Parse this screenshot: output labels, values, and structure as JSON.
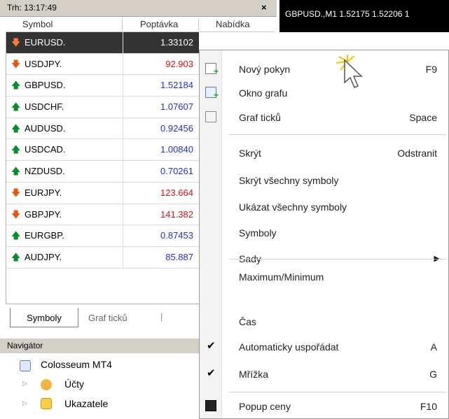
{
  "market_watch": {
    "title": "Trh: 13:17:49",
    "close_glyph": "×",
    "columns": {
      "symbol": "Symbol",
      "bid": "Poptávka",
      "ask": "Nabídka"
    },
    "rows": [
      {
        "symbol": "EURUSD.",
        "bid": "1.33102",
        "dir": "down",
        "selected": true
      },
      {
        "symbol": "USDJPY.",
        "bid": "92.903",
        "dir": "down"
      },
      {
        "symbol": "GBPUSD.",
        "bid": "1.52184",
        "dir": "up"
      },
      {
        "symbol": "USDCHF.",
        "bid": "1.07607",
        "dir": "up"
      },
      {
        "symbol": "AUDUSD.",
        "bid": "0.92456",
        "dir": "up"
      },
      {
        "symbol": "USDCAD.",
        "bid": "1.00840",
        "dir": "up"
      },
      {
        "symbol": "NZDUSD.",
        "bid": "0.70261",
        "dir": "up"
      },
      {
        "symbol": "EURJPY.",
        "bid": "123.664",
        "dir": "down"
      },
      {
        "symbol": "GBPJPY.",
        "bid": "141.382",
        "dir": "down"
      },
      {
        "symbol": "EURGBP.",
        "bid": "0.87453",
        "dir": "up"
      },
      {
        "symbol": "AUDJPY.",
        "bid": "85.887",
        "dir": "up"
      }
    ],
    "tabs": {
      "symbols": "Symboly",
      "tick_chart": "Graf ticků",
      "extra": "|"
    }
  },
  "chart_tab": {
    "title": "GBPUSD.,M1  1.52175 1.52206 1"
  },
  "navigator": {
    "title": "Navigátor",
    "items": [
      "Colosseum MT4",
      "Účty",
      "Ukazatele"
    ]
  },
  "context_menu": {
    "items": {
      "new_order": {
        "label": "Nový pokyn",
        "shortcut": "F9"
      },
      "chart_window": {
        "label": "Okno grafu"
      },
      "tick_chart": {
        "label": "Graf ticků",
        "shortcut": "Space"
      },
      "hide": {
        "label": "Skrýt",
        "shortcut": "Odstranit"
      },
      "hide_all": {
        "label": "Skrýt všechny symboly"
      },
      "show_all": {
        "label": "Ukázat všechny symboly"
      },
      "symbols": {
        "label": "Symboly"
      },
      "sets": {
        "label": "Sady"
      },
      "high_low": {
        "label": "Maximum/Minimum"
      },
      "time": {
        "label": "Čas"
      },
      "auto_arrange": {
        "label": "Automaticky uspořádat",
        "shortcut": "A",
        "checked": true
      },
      "grid": {
        "label": "Mřížka",
        "shortcut": "G",
        "checked": true
      },
      "popup_prices": {
        "label": "Popup ceny",
        "shortcut": "F10"
      }
    }
  },
  "colors": {
    "up": "#0a8a2a",
    "down": "#e05a1a",
    "bid_up": "#1f2fd8",
    "bid_down": "#e01010",
    "selected_row": "#333333"
  }
}
